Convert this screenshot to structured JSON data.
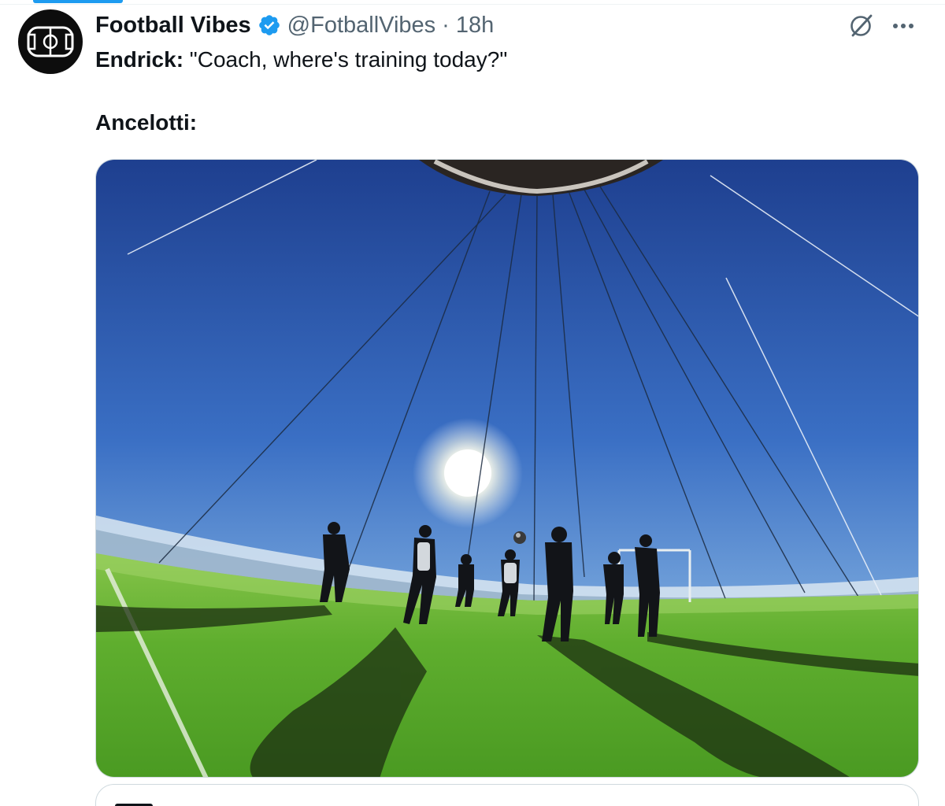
{
  "tweet": {
    "author_name": "Football Vibes",
    "author_handle": "@FotballVibes",
    "separator": "·",
    "timestamp": "18h",
    "verified": true,
    "text_line1_speaker": "Endrick:",
    "text_line1_quote": " \"Coach, where's training today?\"",
    "text_line2_speaker": "Ancelotti:"
  },
  "icons": {
    "verified": "verified-badge-icon",
    "grok": "grok-icon",
    "more": "more-icon",
    "avatar": "football-pitch-logo"
  },
  "colors": {
    "accent": "#1d9bf0",
    "text_primary": "#0f1419",
    "text_secondary": "#536471",
    "border": "#cfd9de"
  }
}
